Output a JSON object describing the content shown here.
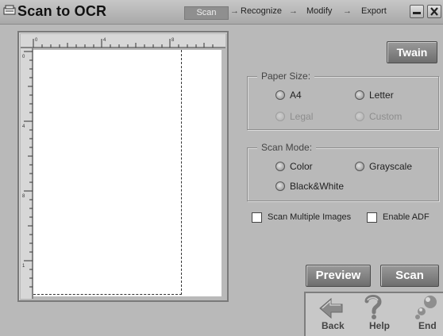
{
  "window": {
    "title": "Scan to OCR"
  },
  "steps": [
    "Scan",
    "Recognize",
    "Modify",
    "Export"
  ],
  "toolbar": {
    "twain": "Twain"
  },
  "ruler": {
    "top_marks": [
      "0",
      "4",
      "8"
    ],
    "left_marks": [
      "0",
      "4",
      "8",
      "1"
    ]
  },
  "paper_size": {
    "title": "Paper Size:",
    "options": [
      {
        "label": "A4",
        "enabled": true,
        "selected": false
      },
      {
        "label": "Letter",
        "enabled": true,
        "selected": false
      },
      {
        "label": "Legal",
        "enabled": false,
        "selected": false
      },
      {
        "label": "Custom",
        "enabled": false,
        "selected": false
      }
    ]
  },
  "scan_mode": {
    "title": "Scan Mode:",
    "options": [
      {
        "label": "Color",
        "enabled": true
      },
      {
        "label": "Grayscale",
        "enabled": true
      },
      {
        "label": "Black&White",
        "enabled": true
      }
    ]
  },
  "options": {
    "scan_multiple": "Scan Multiple Images",
    "enable_adf": "Enable ADF"
  },
  "actions": {
    "preview": "Preview",
    "scan": "Scan"
  },
  "nav": {
    "back": "Back",
    "help": "Help",
    "end": "End"
  },
  "colors": {
    "background": "#b9b9b9",
    "button": "#7f7f7f",
    "active_step": "#8f8f8f"
  }
}
